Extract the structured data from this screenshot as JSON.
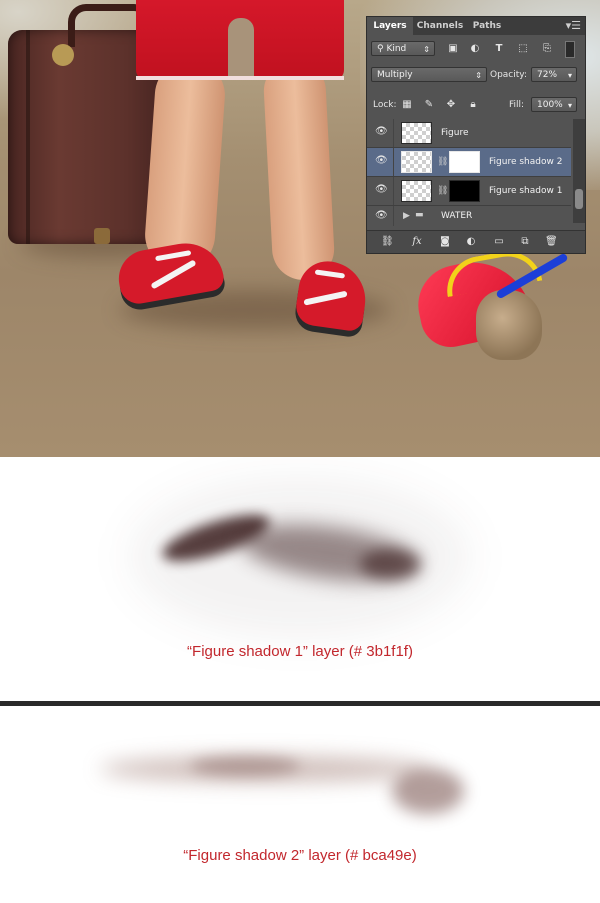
{
  "panel": {
    "tabs": [
      "Layers",
      "Channels",
      "Paths"
    ],
    "menu_icon": "panel-menu-icon",
    "filter_label": "Kind",
    "blend_mode": "Multiply",
    "opacity_label": "Opacity:",
    "opacity_value": "72%",
    "lock_label": "Lock:",
    "fill_label": "Fill:",
    "fill_value": "100%",
    "layers": [
      {
        "name": "Figure",
        "selected": false
      },
      {
        "name": "Figure shadow 2",
        "selected": true
      },
      {
        "name": "Figure shadow 1",
        "selected": false
      },
      {
        "name": "WATER",
        "selected": false,
        "type": "group"
      }
    ],
    "bottom_icons": [
      "link-icon",
      "fx-icon",
      "mask-icon",
      "adjustment-icon",
      "folder-icon",
      "new-layer-icon",
      "trash-icon"
    ]
  },
  "sections": {
    "shadow1_caption": "“Figure shadow 1” layer (# 3b1f1f)",
    "shadow2_caption": "“Figure shadow 2” layer (# bca49e)"
  },
  "colors": {
    "shadow1": "#3b1f1f",
    "shadow2": "#bca49e",
    "caption": "#c2272d",
    "selected_layer": "#5a6b89"
  }
}
